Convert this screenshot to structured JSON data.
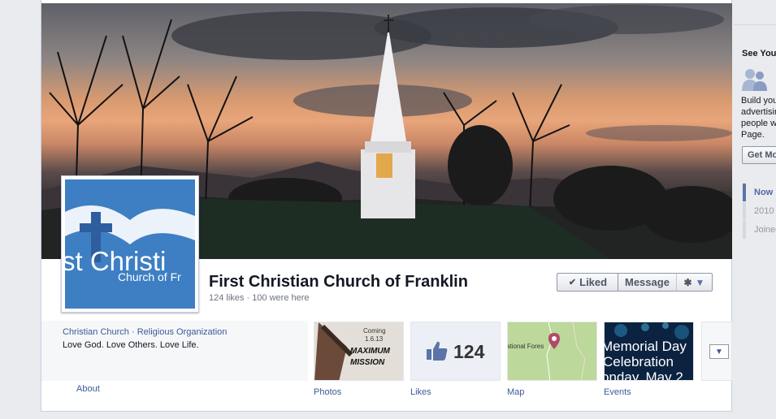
{
  "page": {
    "name": "First Christian Church of Franklin",
    "stats": "124 likes · 100 were here",
    "categories": "Christian Church · Religious Organization",
    "tagline": "Love God. Love Others. Love Life.",
    "profile_text_line1": "st Christi",
    "profile_text_line2": "Church of Fr"
  },
  "actions": {
    "liked_label": "Liked",
    "message_label": "Message"
  },
  "apps": {
    "about_label": "About",
    "photos_label": "Photos",
    "photos_tile_text1": "Coming",
    "photos_tile_text2": "1.6.13",
    "photos_tile_text3": "MAXIMUM",
    "photos_tile_text4": "MISSION",
    "likes_label": "Likes",
    "likes_count": "124",
    "map_label": "Map",
    "map_tile_text": "ational Fores",
    "events_label": "Events",
    "events_line1": "Memorial Day",
    "events_line2": "Celebration",
    "events_line3": "onday, May 2"
  },
  "sidebar": {
    "title": "See You",
    "text1": "Build you",
    "text2": "advertisin",
    "text3": "people w",
    "text4": "Page.",
    "button_label": "Get Mo",
    "timeline": [
      "Now",
      "2010",
      "Joined"
    ]
  },
  "colors": {
    "link": "#3b5998",
    "profile_blue": "#3e7fc3"
  }
}
